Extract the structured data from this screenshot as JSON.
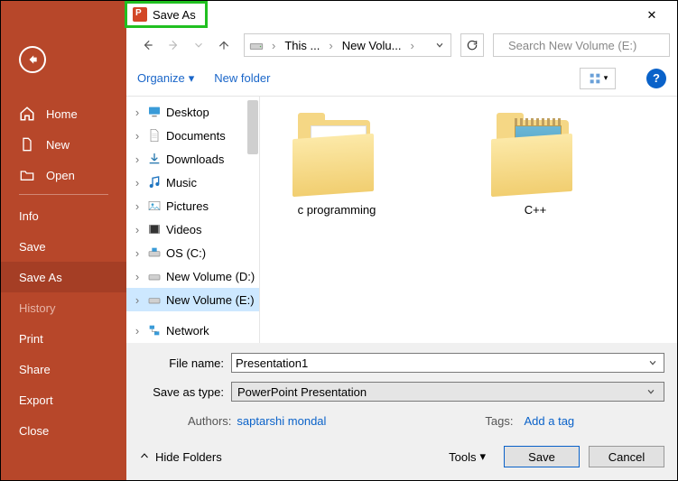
{
  "backstage": {
    "items": [
      {
        "label": "Home",
        "icon": "home"
      },
      {
        "label": "New",
        "icon": "new"
      },
      {
        "label": "Open",
        "icon": "open"
      }
    ],
    "sub": [
      "Info",
      "Save",
      "Save As",
      "History",
      "Print",
      "Share",
      "Export",
      "Close"
    ],
    "selected": "Save As"
  },
  "dialog": {
    "title": "Save As",
    "close": "✕",
    "breadcrumbs": [
      "This ...",
      "New Volu..."
    ],
    "search_placeholder": "Search New Volume (E:)",
    "organize": "Organize",
    "newfolder": "New folder",
    "help": "?",
    "tree": [
      {
        "label": "Desktop",
        "icon": "desktop",
        "indent": 1,
        "exp": "›"
      },
      {
        "label": "Documents",
        "icon": "documents",
        "indent": 1,
        "exp": "›"
      },
      {
        "label": "Downloads",
        "icon": "downloads",
        "indent": 1,
        "exp": "›"
      },
      {
        "label": "Music",
        "icon": "music",
        "indent": 1,
        "exp": "›"
      },
      {
        "label": "Pictures",
        "icon": "pictures",
        "indent": 1,
        "exp": "›"
      },
      {
        "label": "Videos",
        "icon": "videos",
        "indent": 1,
        "exp": "›"
      },
      {
        "label": "OS (C:)",
        "icon": "drive",
        "indent": 1,
        "exp": "›"
      },
      {
        "label": "New Volume (D:)",
        "icon": "drive",
        "indent": 1,
        "exp": "›"
      },
      {
        "label": "New Volume (E:)",
        "icon": "drive",
        "indent": 1,
        "exp": "›",
        "selected": true
      },
      {
        "label": "Network",
        "icon": "network",
        "indent": 0,
        "exp": "›",
        "gap": true
      }
    ],
    "files": [
      {
        "label": "c programming",
        "type": "folder-a"
      },
      {
        "label": "C++",
        "type": "folder-b"
      }
    ],
    "filename_label": "File name:",
    "filename_value": "Presentation1",
    "type_label": "Save as type:",
    "type_value": "PowerPoint Presentation",
    "authors_label": "Authors:",
    "authors_value": "saptarshi mondal",
    "tags_label": "Tags:",
    "tags_value": "Add a tag",
    "hide_folders": "Hide Folders",
    "tools": "Tools",
    "save": "Save",
    "cancel": "Cancel"
  }
}
